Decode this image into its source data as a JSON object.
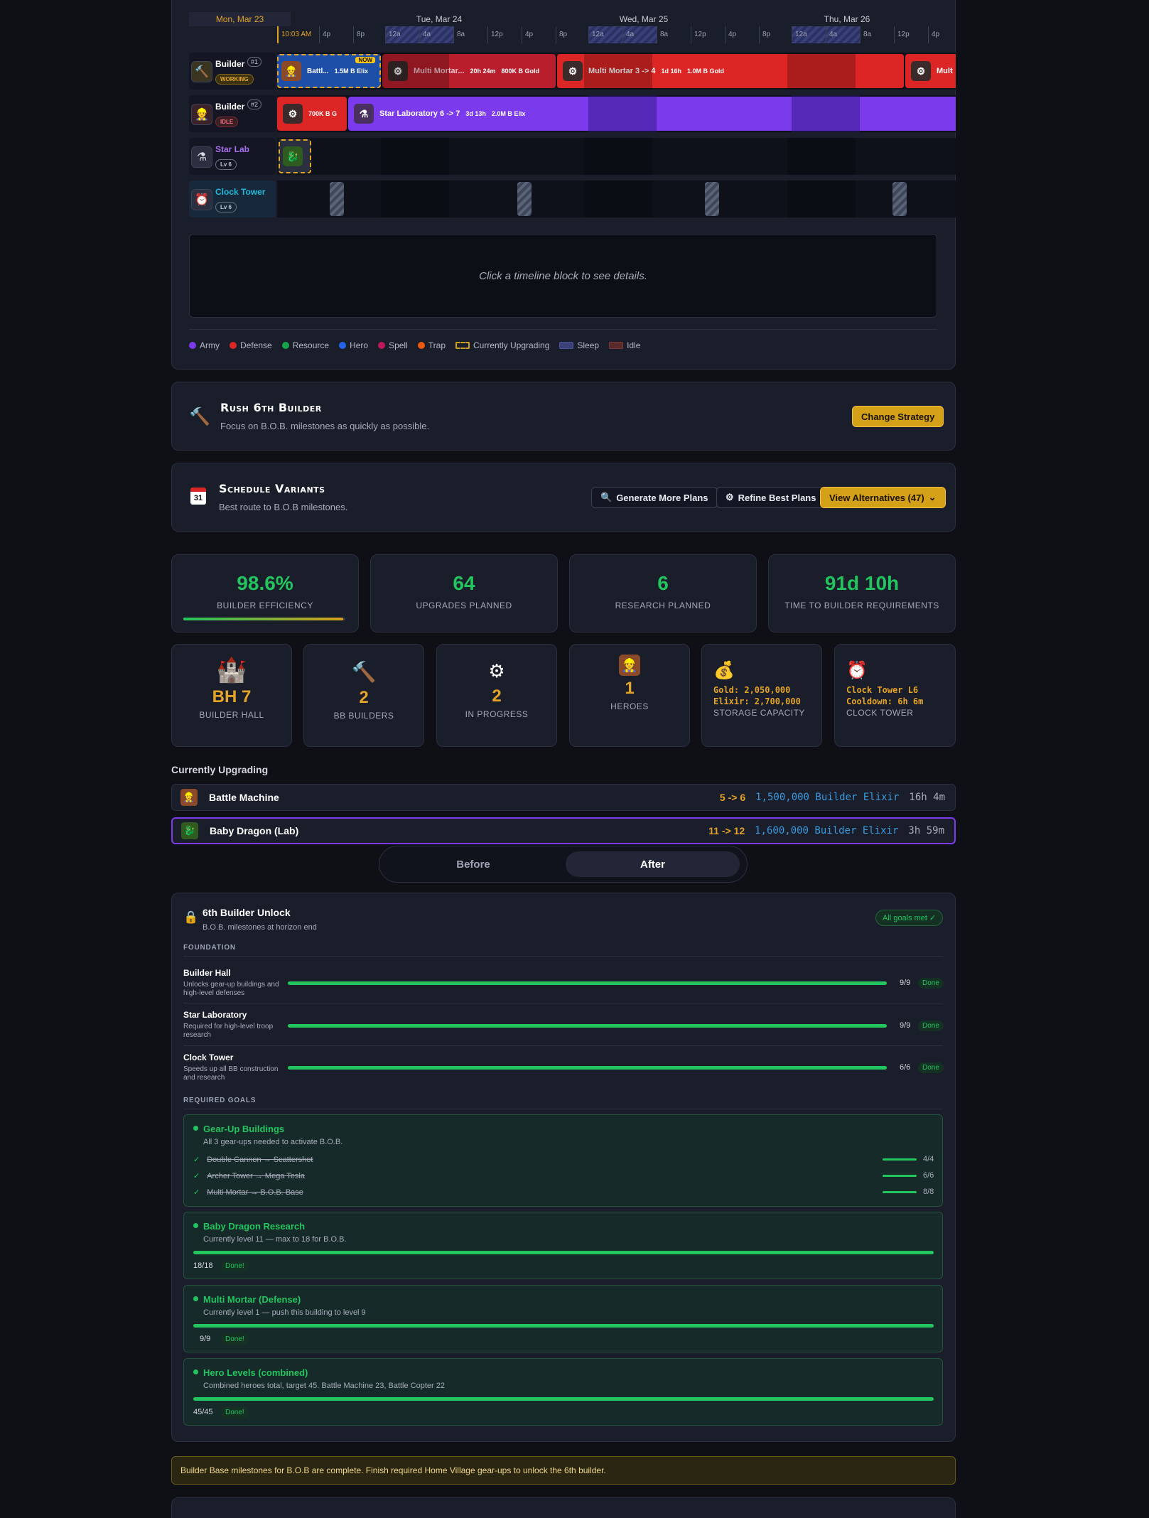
{
  "timeline": {
    "days": [
      "Mon, Mar 23",
      "Tue, Mar 24",
      "Wed, Mar 25",
      "Thu, Mar 26"
    ],
    "now_label": "10:03 AM",
    "hours": [
      "4p",
      "8p",
      "12a",
      "4a",
      "8a",
      "12p",
      "4p",
      "8p",
      "12a",
      "4a",
      "8a",
      "12p",
      "4p",
      "8p",
      "12a",
      "4a",
      "8a",
      "12p",
      "4p"
    ],
    "rows": [
      {
        "name": "Builder",
        "num": "#1",
        "status": "WORKING",
        "blocks": [
          {
            "label": "Battl...",
            "extra": "1.5M B Elix",
            "tag": "NOW"
          },
          {
            "label": "Multi Mortar...",
            "time": "20h 24m",
            "cost": "800K B Gold"
          },
          {
            "label": "Multi Mortar 3 -> 4",
            "time": "1d 16h",
            "cost": "1.0M B Gold"
          },
          {
            "label": "Mult"
          }
        ]
      },
      {
        "name": "Builder",
        "num": "#2",
        "status": "IDLE",
        "blocks": [
          {
            "label": "700K B G"
          },
          {
            "label": "Star Laboratory 6 -> 7",
            "time": "3d 13h",
            "cost": "2.0M B Elix"
          }
        ]
      },
      {
        "name": "Star Lab",
        "level": "Lv 6"
      },
      {
        "name": "Clock Tower",
        "level": "Lv 6"
      }
    ],
    "detail_placeholder": "Click a timeline block to see details.",
    "legend": [
      "Army",
      "Defense",
      "Resource",
      "Hero",
      "Spell",
      "Trap",
      "Currently Upgrading",
      "Sleep",
      "Idle"
    ],
    "legend_colors": [
      "#7c3aed",
      "#dc2626",
      "#16a34a",
      "#2563eb",
      "#be185d",
      "#ea580c",
      "#d4a017",
      "#3a4178",
      "#5a2a2a"
    ]
  },
  "strategy": {
    "title": "Rush 6th Builder",
    "subtitle": "Focus on B.O.B. milestones as quickly as possible.",
    "button": "Change Strategy"
  },
  "variants": {
    "title": "Schedule Variants",
    "subtitle": "Best route to B.O.B milestones.",
    "generate": "Generate More Plans",
    "refine": "Refine Best Plans",
    "alternatives": "View Alternatives (47)"
  },
  "stats": [
    {
      "value": "98.6%",
      "label": "BUILDER EFFICIENCY"
    },
    {
      "value": "64",
      "label": "UPGRADES PLANNED"
    },
    {
      "value": "6",
      "label": "RESEARCH PLANNED"
    },
    {
      "value": "91d 10h",
      "label": "TIME TO BUILDER REQUIREMENTS"
    }
  ],
  "builder_efficiency_fraction": 0.986,
  "mini": {
    "bh": {
      "value": "BH 7",
      "label": "BUILDER HALL"
    },
    "builders": {
      "value": "2",
      "label": "BB BUILDERS"
    },
    "progress": {
      "value": "2",
      "label": "IN PROGRESS"
    },
    "heroes": {
      "value": "1",
      "label": "HEROES"
    },
    "storage": {
      "gold": "Gold: 2,050,000",
      "elixir": "Elixir: 2,700,000",
      "label": "STORAGE CAPACITY"
    },
    "clock": {
      "line1": "Clock Tower L6",
      "line2": "Cooldown: 6h 6m",
      "label": "CLOCK TOWER"
    }
  },
  "upgrading": {
    "title": "Currently Upgrading",
    "items": [
      {
        "name": "Battle Machine",
        "levels": "5 -> 6",
        "cost": "1,500,000 Builder Elixir",
        "time": "16h 4m"
      },
      {
        "name": "Baby Dragon (Lab)",
        "levels": "11 -> 12",
        "cost": "1,600,000 Builder Elixir",
        "time": "3h 59m"
      }
    ]
  },
  "toggle": {
    "before": "Before",
    "after": "After"
  },
  "unlock": {
    "title": "6th Builder Unlock",
    "subtitle": "B.O.B. milestones at horizon end",
    "badge": "All goals met ✓",
    "foundation_label": "FOUNDATION",
    "foundation": [
      {
        "name": "Builder Hall",
        "desc": "Unlocks gear-up buildings and high-level defenses",
        "count": "9/9",
        "status": "Done"
      },
      {
        "name": "Star Laboratory",
        "desc": "Required for high-level troop research",
        "count": "9/9",
        "status": "Done"
      },
      {
        "name": "Clock Tower",
        "desc": "Speeds up all BB construction and research",
        "count": "6/6",
        "status": "Done"
      }
    ],
    "required_label": "REQUIRED GOALS",
    "gearup": {
      "title": "Gear-Up Buildings",
      "desc": "All 3 gear-ups needed to activate B.O.B.",
      "items": [
        {
          "name": "Double Cannon → Scattershot",
          "count": "4/4"
        },
        {
          "name": "Archer Tower → Mega Tesla",
          "count": "6/6"
        },
        {
          "name": "Multi Mortar → B.O.B. Base",
          "count": "8/8"
        }
      ]
    },
    "goals": [
      {
        "title": "Baby Dragon Research",
        "desc": "Currently level 11 — max to 18 for B.O.B.",
        "count": "18/18",
        "status": "Done!"
      },
      {
        "title": "Multi Mortar (Defense)",
        "desc": "Currently level 1 — push this building to level 9",
        "count": "9/9",
        "status": "Done!"
      },
      {
        "title": "Hero Levels (combined)",
        "desc": "Combined heroes total, target 45. Battle Machine 23, Battle Copter 22",
        "count": "45/45",
        "status": "Done!"
      }
    ]
  },
  "notice": "Builder Base milestones for B.O.B are complete. Finish required Home Village gear-ups to unlock the 6th builder."
}
